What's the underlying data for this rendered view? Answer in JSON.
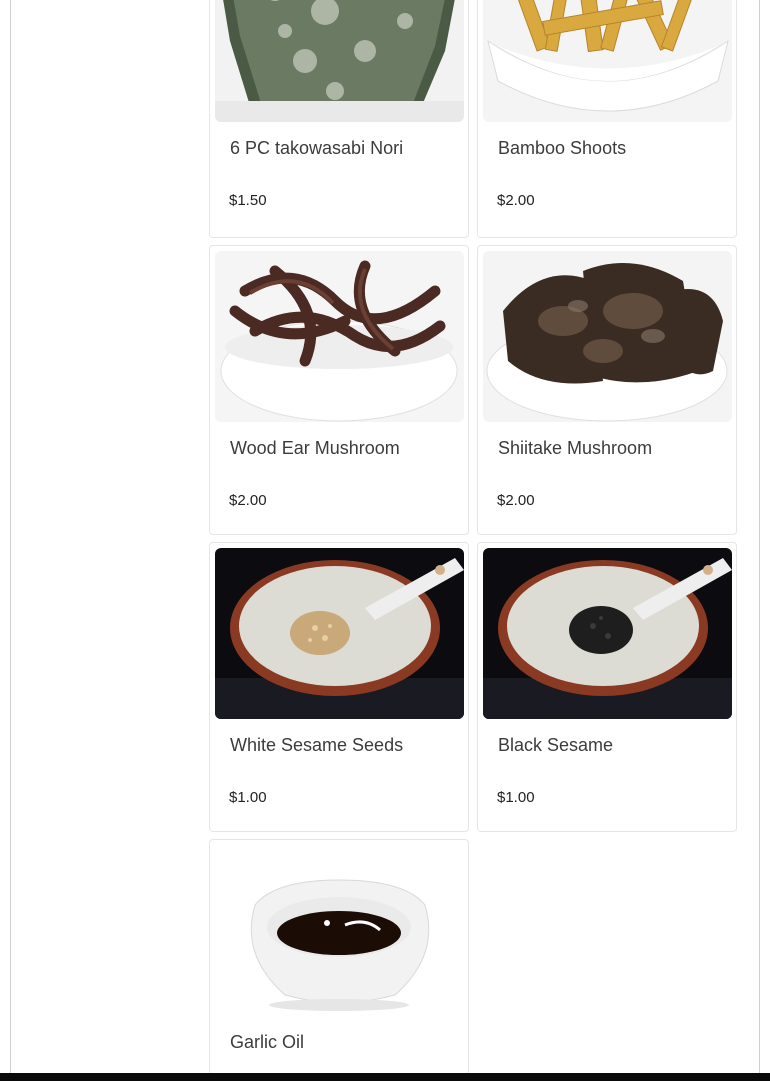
{
  "menu": {
    "items": [
      {
        "name": "6 PC takowasabi Nori",
        "price": "$1.50",
        "image_icon": "nori-seaweed-image"
      },
      {
        "name": "Bamboo Shoots",
        "price": "$2.00",
        "image_icon": "bamboo-shoots-image"
      },
      {
        "name": "Wood Ear Mushroom",
        "price": "$2.00",
        "image_icon": "wood-ear-mushroom-image"
      },
      {
        "name": "Shiitake Mushroom",
        "price": "$2.00",
        "image_icon": "shiitake-mushroom-image"
      },
      {
        "name": "White Sesame Seeds",
        "price": "$1.00",
        "image_icon": "white-sesame-image"
      },
      {
        "name": "Black Sesame",
        "price": "$1.00",
        "image_icon": "black-sesame-image"
      },
      {
        "name": "Garlic Oil",
        "price": "",
        "image_icon": "garlic-oil-image"
      }
    ]
  }
}
